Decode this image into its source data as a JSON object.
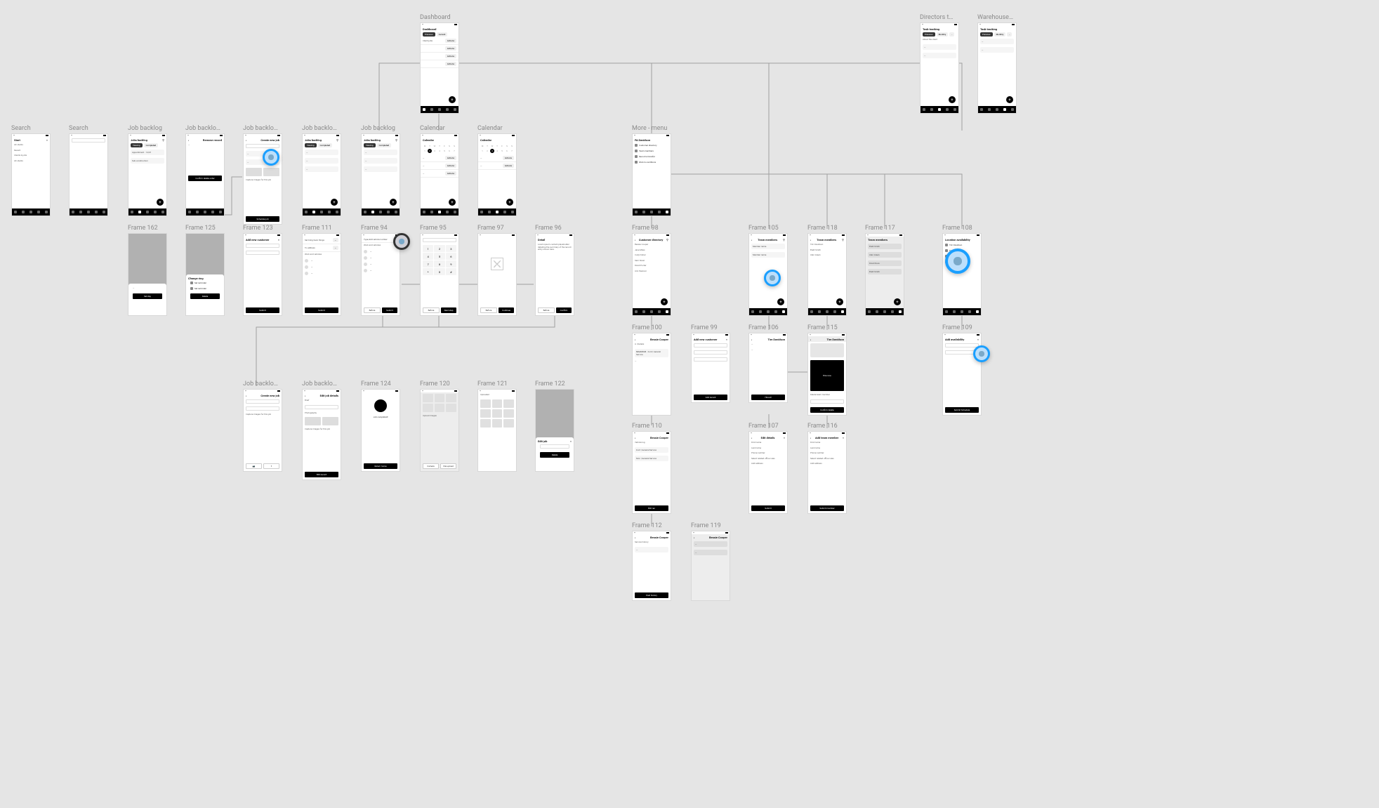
{
  "dashboard": {
    "label": "Dashboard",
    "title": "Dashboard",
    "chips": [
      "Previous",
      "Current"
    ],
    "rows": [
      {
        "label": "Client jobs",
        "val": "Actions"
      },
      {
        "label": "",
        "val": "Actions"
      },
      {
        "label": "",
        "val": "Actions"
      },
      {
        "label": "",
        "val": "Actions"
      }
    ]
  },
  "directors": {
    "label": "Directors t…",
    "title": "Task tracking",
    "chips": [
      "Previous",
      "Monthly",
      "-"
    ],
    "sub": "About the client"
  },
  "warehouse": {
    "label": "Warehouse…",
    "title": "Task tracking",
    "chips": [
      "Previous",
      "Monthly",
      "-"
    ]
  },
  "search1": {
    "label": "Search",
    "title": "Start",
    "rows": [
      "All clients",
      "Recent",
      "Clients & jobs",
      "All clients"
    ]
  },
  "search2": {
    "label": "Search",
    "title": ""
  },
  "jobBacklog1": {
    "label": "Job backlog",
    "title": "Jobs backlog",
    "chips": [
      "Viewing",
      "Completed"
    ],
    "rows": [
      {
        "a": "Appointment",
        "b": "Actions",
        "c": "14/01"
      },
      {
        "a": "Sub-construction",
        "b": "Actions",
        "c": "All team..."
      }
    ]
  },
  "jobBacklog2": {
    "label": "Job backlo…",
    "title": "Remove record",
    "btn": "Confirm delete order"
  },
  "jobBacklog3": {
    "label": "Job backlo…",
    "title": "Create new job",
    "bottom": "Schedule job"
  },
  "jobBacklog4": {
    "label": "Job backlo…",
    "title": "Jobs backlog",
    "chips": [
      "Viewing",
      "Completed"
    ]
  },
  "jobBacklog5": {
    "label": "Job backlog",
    "title": "Jobs backlog",
    "chips": [
      "Viewing",
      "Completed"
    ]
  },
  "jobBacklog6": {
    "label": "Job backlo…",
    "title": "Create new job",
    "caption": "Capture images for this job",
    "btn": "Submit"
  },
  "jobBacklog7": {
    "label": "Job backlo…",
    "title": "Edit job details",
    "field1": "Brief",
    "field2": "Photography",
    "caption": "Capture images for this job",
    "btn": "Edit record"
  },
  "calendar1": {
    "label": "Calendar",
    "title": "Calendar",
    "days": [
      "M",
      "T",
      "W",
      "T",
      "F",
      "S",
      "S"
    ],
    "nums": [
      1,
      2,
      3,
      4,
      5,
      6,
      7,
      8,
      9,
      10,
      11,
      12,
      13,
      14
    ],
    "rows": [
      "Actions",
      "Actions",
      "Actions",
      "Actions"
    ]
  },
  "calendar2": {
    "label": "Calendar",
    "title": "Calendar",
    "days": [
      "M",
      "T",
      "W",
      "T",
      "F",
      "S",
      "S"
    ],
    "nums": [
      1,
      2,
      3,
      4,
      5,
      6,
      7,
      8,
      9,
      10,
      11,
      12,
      13,
      14
    ],
    "rows": [
      "Actions",
      "Actions"
    ]
  },
  "more": {
    "label": "More - menu",
    "title": "FA Davidson",
    "items": [
      "Customer directory",
      "Team members",
      "Record a transfer",
      "Work & conditions"
    ]
  },
  "f162": {
    "label": "Frame 162",
    "btn": "Set day"
  },
  "f125": {
    "label": "Frame 125",
    "header": "Change ring",
    "items": [
      "Set reminder",
      "Set reminder"
    ],
    "btn": "Delete"
  },
  "f123": {
    "label": "Frame 123",
    "title": "Add new customer",
    "btn": "Submit"
  },
  "f111": {
    "label": "Frame 111",
    "rows": [
      "Set bring back things",
      "To address"
    ],
    "section": "Work and vehicles",
    "btn": "Submit"
  },
  "f94": {
    "label": "Frame 94",
    "rows": [
      "Type/add vehicle number"
    ],
    "section": "Work and vehicles",
    "btns": [
      "Before",
      "Submit"
    ]
  },
  "f95": {
    "label": "Frame 95",
    "keys": [
      "1",
      "2",
      "3",
      "4",
      "5",
      "6",
      "7",
      "8",
      "9",
      "*",
      "0",
      "#"
    ],
    "btns": [
      "Before",
      "Next step"
    ]
  },
  "f97": {
    "label": "Frame 97",
    "btns": [
      "Before",
      "Continue"
    ]
  },
  "f96": {
    "label": "Frame 96",
    "title": "Detail",
    "btns": [
      "Before",
      "Confirm"
    ]
  },
  "f98": {
    "label": "Frame 98",
    "title": "Customer directory",
    "rows": [
      "Bessie Cooper",
      "Jane Miles",
      "Cody Fisher",
      "Sam Sloan",
      "David Porter",
      "Ann Pearson"
    ]
  },
  "f100": {
    "label": "Frame 100",
    "title": "Bessie Cooper",
    "sub": "A | Details",
    "vehicle": "Ford | General Service",
    "id": "SCL32C24"
  },
  "f99": {
    "label": "Frame 99",
    "title": "Add new customer",
    "btn": "Add record"
  },
  "f110": {
    "label": "Frame 110",
    "title": "Bessie Cooper",
    "rows": [
      "Vehicle log",
      "Ford | General Service",
      "Mon | General Service"
    ],
    "btn": "Edit rec"
  },
  "f112": {
    "label": "Frame 112",
    "title": "Bessie Cooper",
    "rows": [
      "Service history"
    ],
    "btn": "Past history"
  },
  "f119": {
    "label": "Frame 119",
    "title": "Bessie Cooper",
    "sheet": "Select"
  },
  "f105": {
    "label": "Frame 105",
    "title": "Team members",
    "rows": [
      "Member name",
      "Member name"
    ]
  },
  "f106": {
    "label": "Frame 106",
    "title": "Tim Davidson",
    "btn": "Hire all"
  },
  "f107": {
    "label": "Frame 107",
    "title": "Edit details",
    "rows": [
      "First name",
      "Last name",
      "Phone number",
      "Select related office roles",
      "Add address"
    ],
    "btn": "Submit"
  },
  "f118": {
    "label": "Frame 118",
    "title": "Team members",
    "rows": [
      "Tim Davidson",
      "Brett Smith",
      "Alan Green"
    ]
  },
  "f115": {
    "label": "Frame 115",
    "title": "Tim Davidson",
    "btn": "Hire now",
    "section": "Delete team member",
    "btn2": "Confirm delete"
  },
  "f116": {
    "label": "Frame 116",
    "title": "Add team member",
    "rows": [
      "First name",
      "Last name",
      "Phone number",
      "Select related office roles",
      "Add address"
    ],
    "btn": "Submit member"
  },
  "f117": {
    "label": "Frame 117",
    "title": "Team members",
    "rows": [
      "Brett Smith",
      "Alan Green",
      "David Ross",
      "Brett Smith"
    ]
  },
  "f108": {
    "label": "Frame 108",
    "title": "Location availability",
    "items": [
      "Tim Davidson",
      "Tim Davidson",
      "Tim Davidson",
      "Tim Davidson"
    ]
  },
  "f109": {
    "label": "Frame 109",
    "title": "Add availability",
    "btn": "Submit Schedule"
  },
  "f124": {
    "label": "Frame 124",
    "title": "Job completed!",
    "btn": "Return home"
  },
  "f120": {
    "label": "Frame 120",
    "section": "Upload images",
    "btns": [
      "Camera",
      "File upload"
    ]
  },
  "f121": {
    "label": "Frame 121",
    "caption": "Uploaded"
  },
  "f122": {
    "label": "Frame 122",
    "sheet_title": "Edit job",
    "btn": "Delete"
  },
  "nav": {
    "items": [
      "home",
      "jobs",
      "calendar",
      "team",
      "more"
    ]
  }
}
